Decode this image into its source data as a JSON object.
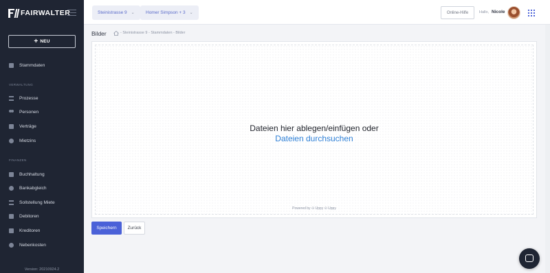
{
  "brand": {
    "name": "FAIRWALTER"
  },
  "sidebar": {
    "new_label": "NEU",
    "top_item": {
      "label": "Stammdaten",
      "icon": "document-icon"
    },
    "section_verwaltung": "VERWALTUNG",
    "verwaltung_items": [
      {
        "label": "Prozesse",
        "icon": "list-icon"
      },
      {
        "label": "Personen",
        "icon": "users-icon"
      },
      {
        "label": "Verträge",
        "icon": "contract-icon"
      },
      {
        "label": "Mietzins",
        "icon": "coin-icon"
      }
    ],
    "section_finanzen": "FINANZEN",
    "finanzen_items": [
      {
        "label": "Buchhaltung",
        "icon": "ledger-icon"
      },
      {
        "label": "Bankabgleich",
        "icon": "bank-icon"
      },
      {
        "label": "Sollstellung Miete",
        "icon": "invoice-icon"
      },
      {
        "label": "Debitoren",
        "icon": "debtor-icon"
      },
      {
        "label": "Kreditoren",
        "icon": "creditor-icon"
      },
      {
        "label": "Nebenkosten",
        "icon": "utilities-icon"
      }
    ],
    "version": "Version: 20210924.2"
  },
  "topbar": {
    "property_selector": "Steinistrasse 9",
    "person_selector": "Homer Simpson + 3",
    "help_label": "Online-Hilfe",
    "greeting": "Hallo,",
    "user_name": "Nicole"
  },
  "page": {
    "title": "Bilder",
    "breadcrumb": "- Steinistrasse 9 - Stammdaten - Bilder"
  },
  "uploader": {
    "drop_text": "Dateien hier ablegen/einfügen oder",
    "browse_text": "Dateien durchsuchen",
    "powered_by": "Powered by ⊙ Uppy ⊙ Uppy"
  },
  "actions": {
    "save_label": "Speichern",
    "back_label": "Zurück"
  },
  "colors": {
    "sidebar_bg": "#1f2533",
    "accent": "#4a61d8",
    "link": "#2d7fd6"
  }
}
